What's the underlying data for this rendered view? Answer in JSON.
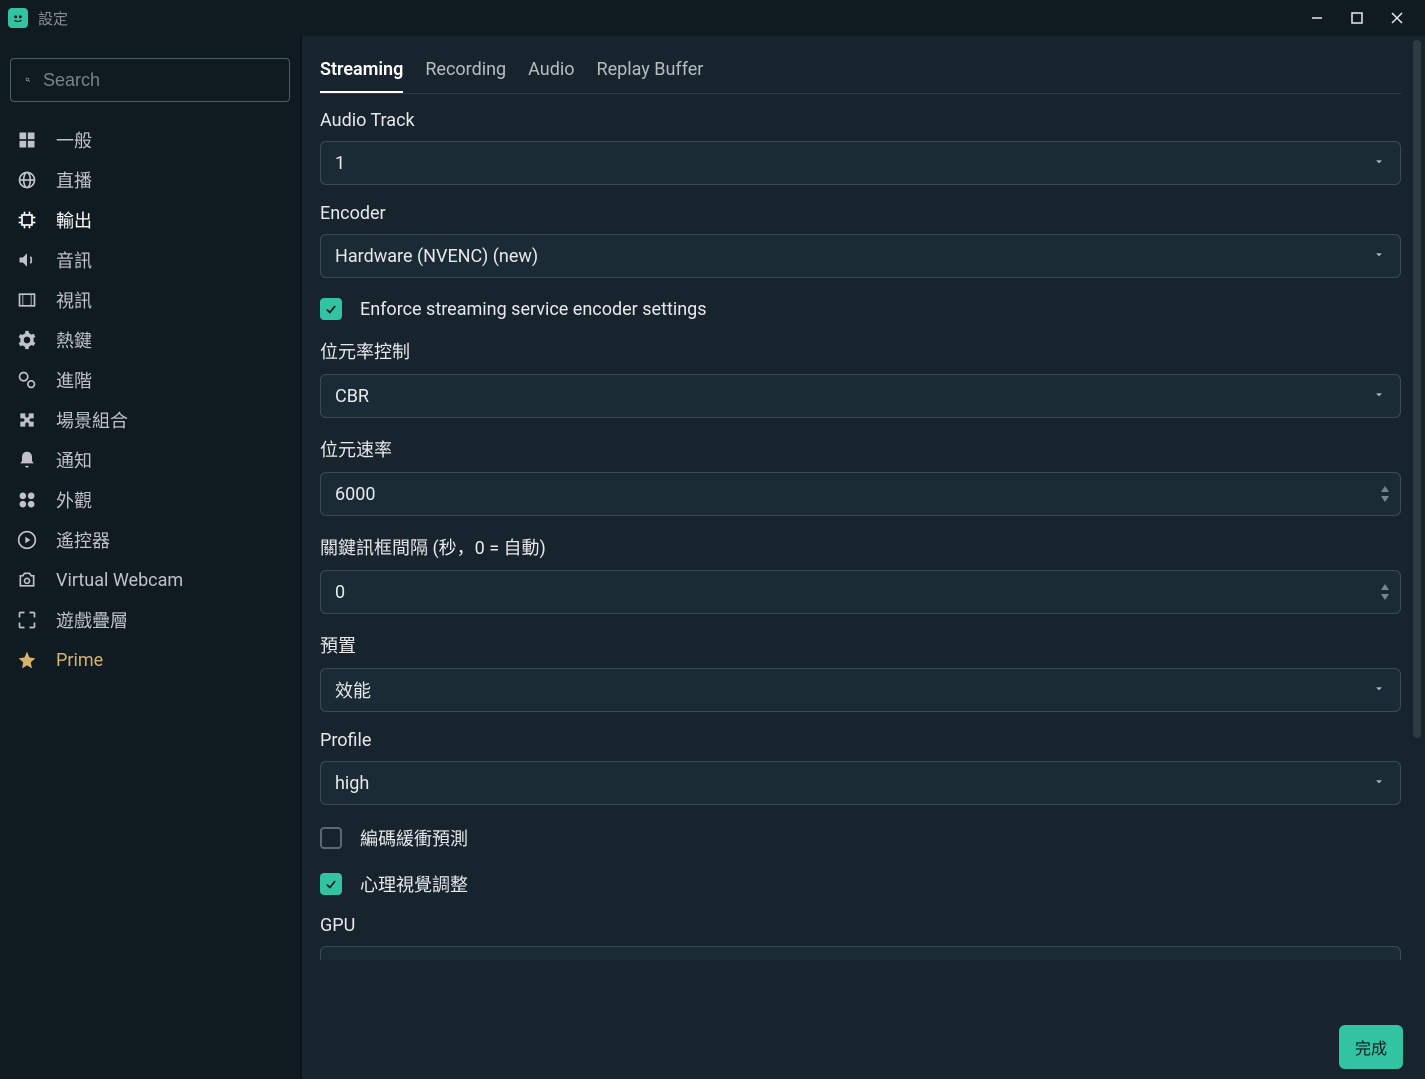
{
  "window": {
    "title": "設定"
  },
  "search": {
    "placeholder": "Search"
  },
  "sidebar": {
    "items": [
      {
        "label": "一般"
      },
      {
        "label": "直播"
      },
      {
        "label": "輸出"
      },
      {
        "label": "音訊"
      },
      {
        "label": "視訊"
      },
      {
        "label": "熱鍵"
      },
      {
        "label": "進階"
      },
      {
        "label": "場景組合"
      },
      {
        "label": "通知"
      },
      {
        "label": "外觀"
      },
      {
        "label": "遙控器"
      },
      {
        "label": "Virtual Webcam"
      },
      {
        "label": "遊戲疊層"
      },
      {
        "label": "Prime"
      }
    ]
  },
  "tabs": {
    "items": [
      {
        "label": "Streaming"
      },
      {
        "label": "Recording"
      },
      {
        "label": "Audio"
      },
      {
        "label": "Replay Buffer"
      }
    ]
  },
  "fields": {
    "audio_track": {
      "label": "Audio Track",
      "value": "1"
    },
    "encoder": {
      "label": "Encoder",
      "value": "Hardware (NVENC) (new)"
    },
    "enforce": {
      "label": "Enforce streaming service encoder settings",
      "checked": true
    },
    "rate_control": {
      "label": "位元率控制",
      "value": "CBR"
    },
    "bitrate": {
      "label": "位元速率",
      "value": "6000"
    },
    "keyframe": {
      "label": "關鍵訊框間隔 (秒，0 = 自動)",
      "value": "0"
    },
    "preset": {
      "label": "預置",
      "value": "效能"
    },
    "profile": {
      "label": "Profile",
      "value": "high"
    },
    "lookahead": {
      "label": "編碼緩衝預測",
      "checked": false
    },
    "psycho": {
      "label": "心理視覺調整",
      "checked": true
    },
    "gpu": {
      "label": "GPU"
    }
  },
  "footer": {
    "done": "完成"
  }
}
